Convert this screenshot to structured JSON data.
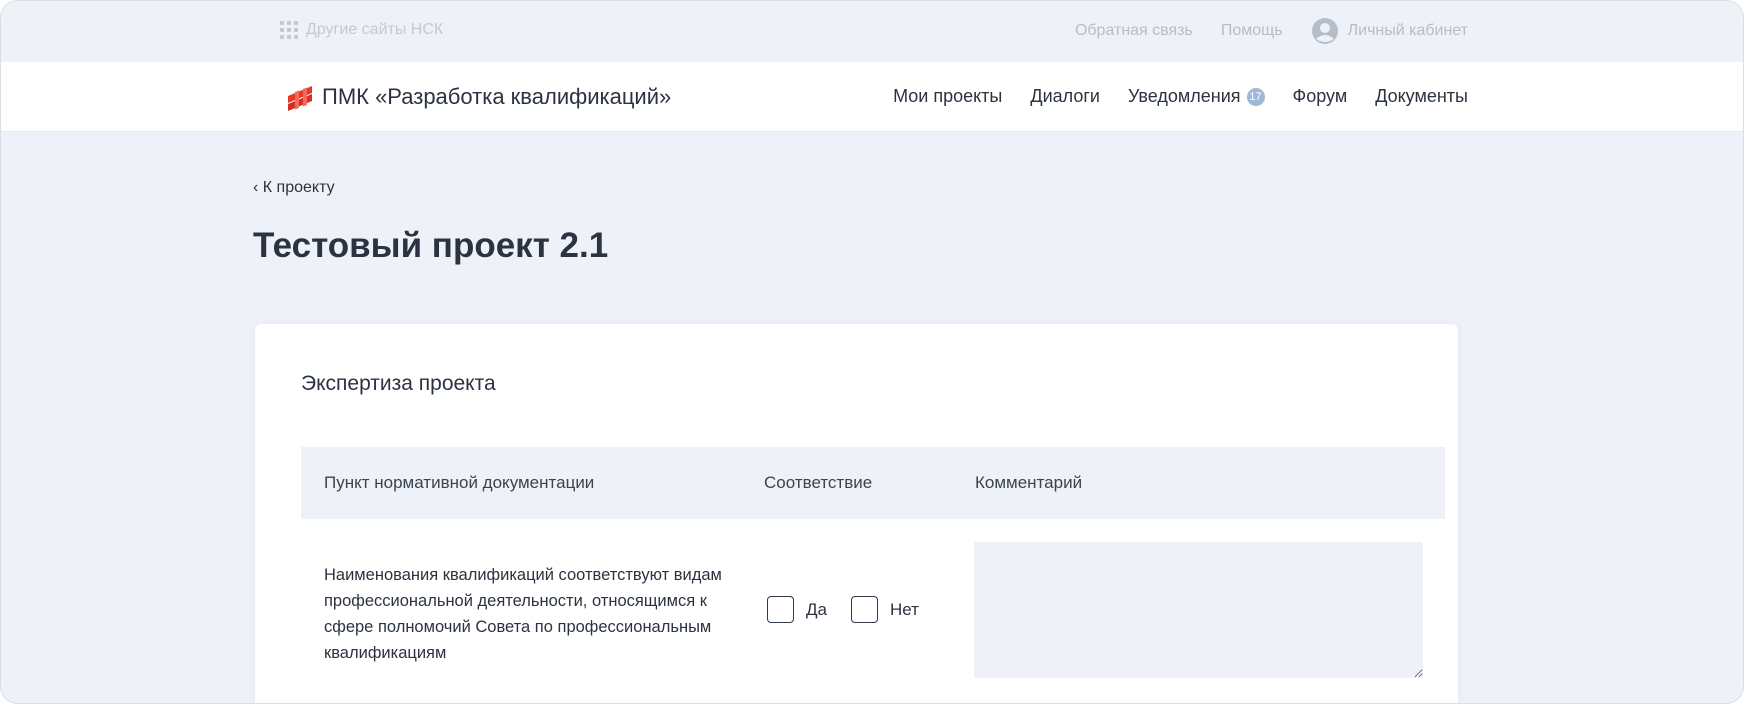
{
  "topbar": {
    "other_sites": "Другие сайты НСК",
    "feedback": "Обратная связь",
    "help": "Помощь",
    "cabinet": "Личный кабинет"
  },
  "header": {
    "logo_text": "ПМК «Разработка квалификаций»",
    "nav": {
      "projects": "Мои проекты",
      "dialogs": "Диалоги",
      "notifications": "Уведомления",
      "notifications_count": "17",
      "forum": "Форум",
      "documents": "Документы"
    }
  },
  "page": {
    "back_link": "‹ К проекту",
    "title": "Тестовый проект 2.1"
  },
  "card": {
    "title": "Экспертиза проекта",
    "columns": [
      "Пункт нормативной документации",
      "Соответствие",
      "Комментарий"
    ],
    "rows": [
      {
        "text": "Наименования квалификаций соответствуют видам профессиональной деятельности, относящимся к сфере полномочий Совета по профессиональным квалификациям",
        "yes_label": "Да",
        "no_label": "Нет",
        "comment": ""
      }
    ]
  },
  "colors": {
    "background": "#eef2f8",
    "text": "#2b3340",
    "muted": "#b5bdc8",
    "logo_red": "#e5382b",
    "badge": "#9fb7d8"
  },
  "icons": [
    "grid-icon",
    "user-icon",
    "logo-icon"
  ]
}
